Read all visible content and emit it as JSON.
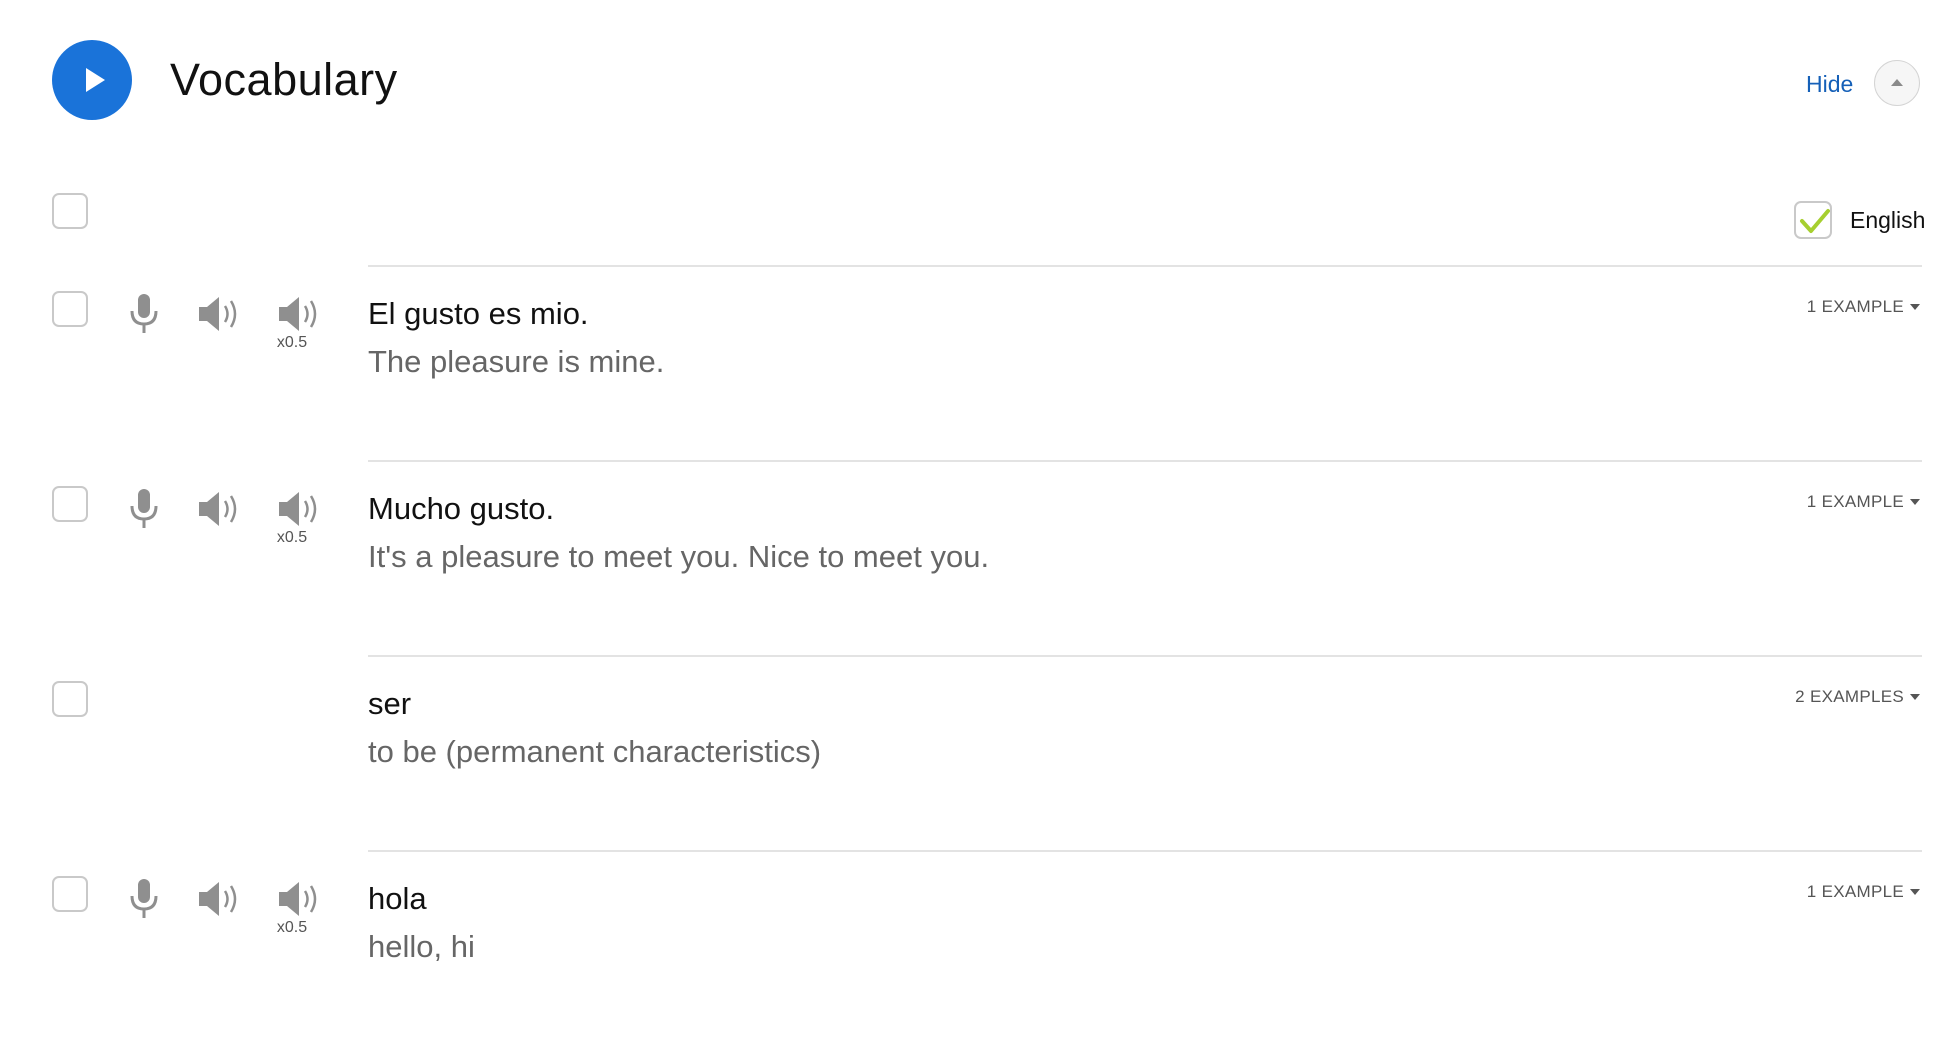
{
  "header": {
    "title": "Vocabulary",
    "hide_label": "Hide",
    "accent_color": "#1a73d9",
    "link_color": "#1560b8"
  },
  "language_toggle": {
    "label": "English",
    "checked": true,
    "check_color": "#a6cf2f"
  },
  "entries": [
    {
      "phrase": "El gusto es mio.",
      "translation": "The pleasure is mine.",
      "examples": "1 EXAMPLE",
      "has_audio": true,
      "slow_label": "x0.5"
    },
    {
      "phrase": "Mucho gusto.",
      "translation": "It's a pleasure to meet you. Nice to meet you.",
      "examples": "1 EXAMPLE",
      "has_audio": true,
      "slow_label": "x0.5"
    },
    {
      "phrase": "ser",
      "translation": "to be (permanent characteristics)",
      "examples": "2 EXAMPLES",
      "has_audio": false
    },
    {
      "phrase": "hola",
      "translation": "hello, hi",
      "examples": "1 EXAMPLE",
      "has_audio": true,
      "slow_label": "x0.5"
    }
  ]
}
